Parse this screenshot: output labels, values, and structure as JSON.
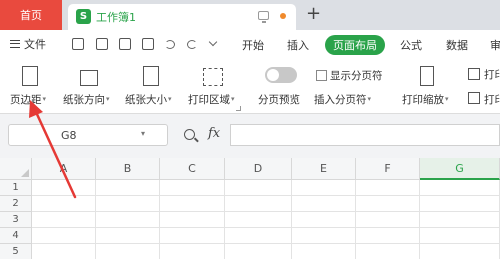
{
  "tabs": {
    "home_label": "首页",
    "doc_icon": "S",
    "doc_title": "工作簿1",
    "new_tab": "+"
  },
  "menu": {
    "file_label": "文件",
    "items": [
      "开始",
      "插入",
      "页面布局",
      "公式",
      "数据",
      "审"
    ],
    "active_index": 2
  },
  "ribbon": {
    "margins_label": "页边距",
    "orientation_label": "纸张方向",
    "size_label": "纸张大小",
    "print_area_label": "打印区域",
    "page_break_preview_label": "分页预览",
    "show_page_breaks_label": "显示分页符",
    "insert_page_break_label": "插入分页符",
    "print_scaling_label": "打印缩放",
    "print_title_label": "打印",
    "print_header_label": "打印"
  },
  "formula_bar": {
    "cell_ref": "G8",
    "fx_label": "fx",
    "formula_value": ""
  },
  "grid": {
    "columns": [
      "A",
      "B",
      "C",
      "D",
      "E",
      "F",
      "G"
    ],
    "selected_column": "G",
    "rows": [
      "1",
      "2",
      "3",
      "4",
      "5"
    ]
  },
  "colors": {
    "accent": "#2aa34a",
    "home_tab": "#e94a3e",
    "annotation": "#e53935"
  }
}
